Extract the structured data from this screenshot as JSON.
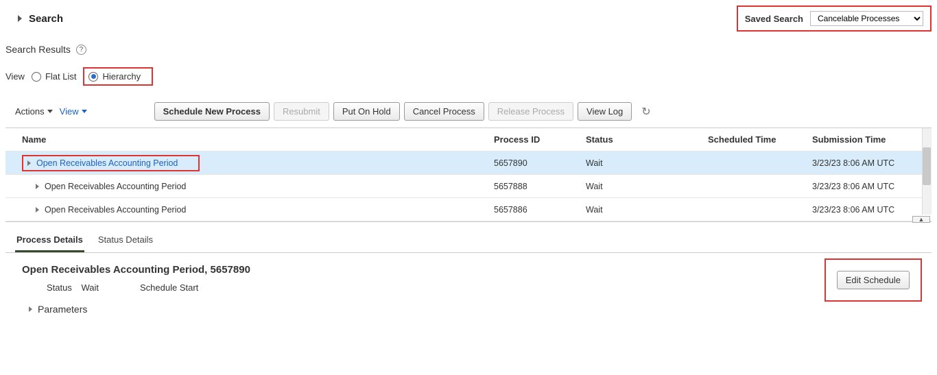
{
  "header": {
    "search_title": "Search",
    "saved_search_label": "Saved Search",
    "saved_search_value": "Cancelable Processes"
  },
  "results": {
    "heading": "Search Results",
    "view_label": "View",
    "flat_list": "Flat List",
    "hierarchy": "Hierarchy"
  },
  "toolbar": {
    "actions": "Actions",
    "view": "View",
    "schedule_new": "Schedule New Process",
    "resubmit": "Resubmit",
    "put_on_hold": "Put On Hold",
    "cancel_process": "Cancel Process",
    "release_process": "Release Process",
    "view_log": "View Log"
  },
  "columns": {
    "name": "Name",
    "process_id": "Process ID",
    "status": "Status",
    "scheduled_time": "Scheduled Time",
    "submission_time": "Submission Time"
  },
  "rows": [
    {
      "name": "Open Receivables Accounting Period",
      "process_id": "5657890",
      "status": "Wait",
      "scheduled": "",
      "submission": "3/23/23 8:06 AM UTC"
    },
    {
      "name": "Open Receivables Accounting Period",
      "process_id": "5657888",
      "status": "Wait",
      "scheduled": "",
      "submission": "3/23/23 8:06 AM UTC"
    },
    {
      "name": "Open Receivables Accounting Period",
      "process_id": "5657886",
      "status": "Wait",
      "scheduled": "",
      "submission": "3/23/23 8:06 AM UTC"
    }
  ],
  "tabs": {
    "process_details": "Process Details",
    "status_details": "Status Details"
  },
  "details": {
    "title": "Open Receivables Accounting Period, 5657890",
    "status_label": "Status",
    "status_value": "Wait",
    "schedule_start_label": "Schedule Start",
    "schedule_start_value": "",
    "parameters": "Parameters",
    "edit_schedule": "Edit Schedule"
  }
}
